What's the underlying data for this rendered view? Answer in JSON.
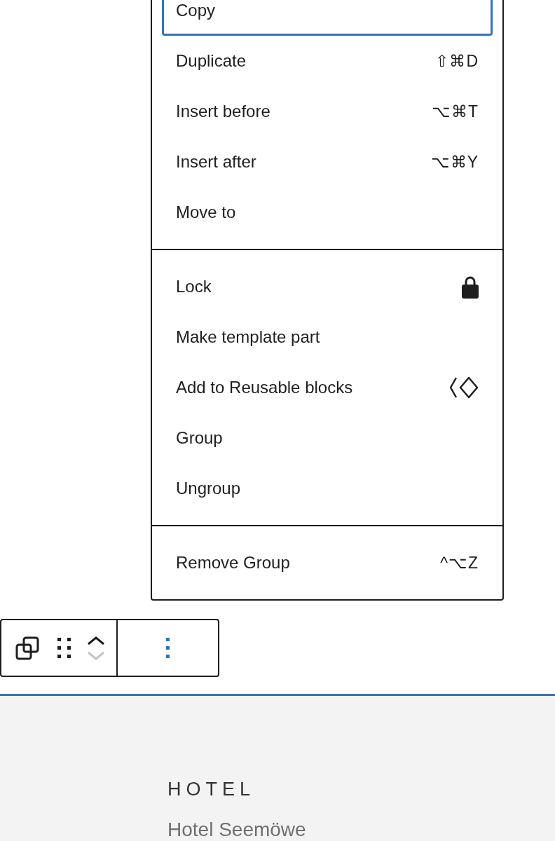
{
  "menu": {
    "sections": [
      {
        "items": [
          {
            "label": "Copy",
            "kind": "plain",
            "selected": true
          },
          {
            "label": "Duplicate",
            "kind": "shortcut",
            "shortcut": "⇧⌘D",
            "selected": false
          },
          {
            "label": "Insert before",
            "kind": "shortcut",
            "shortcut": "⌥⌘T",
            "selected": false
          },
          {
            "label": "Insert after",
            "kind": "shortcut",
            "shortcut": "⌥⌘Y",
            "selected": false
          },
          {
            "label": "Move to",
            "kind": "plain",
            "selected": false
          }
        ]
      },
      {
        "items": [
          {
            "label": "Lock",
            "kind": "lock",
            "selected": false
          },
          {
            "label": "Make template part",
            "kind": "plain",
            "selected": false
          },
          {
            "label": "Add to Reusable blocks",
            "kind": "reusable",
            "selected": false
          },
          {
            "label": "Group",
            "kind": "plain",
            "selected": false
          },
          {
            "label": "Ungroup",
            "kind": "plain",
            "selected": false
          }
        ]
      },
      {
        "items": [
          {
            "label": "Remove Group",
            "kind": "shortcut",
            "shortcut": "^⌥Z",
            "selected": false
          }
        ]
      }
    ]
  },
  "toolbar": {
    "buttons": [
      {
        "kind": "parent"
      },
      {
        "kind": "drag"
      },
      {
        "kind": "mover",
        "up_disabled": false,
        "down_disabled": true
      },
      {
        "kind": "options",
        "expanded": true
      }
    ]
  },
  "content": {
    "eyebrow": "HOTEL",
    "title": "Hotel Seemöwe"
  }
}
